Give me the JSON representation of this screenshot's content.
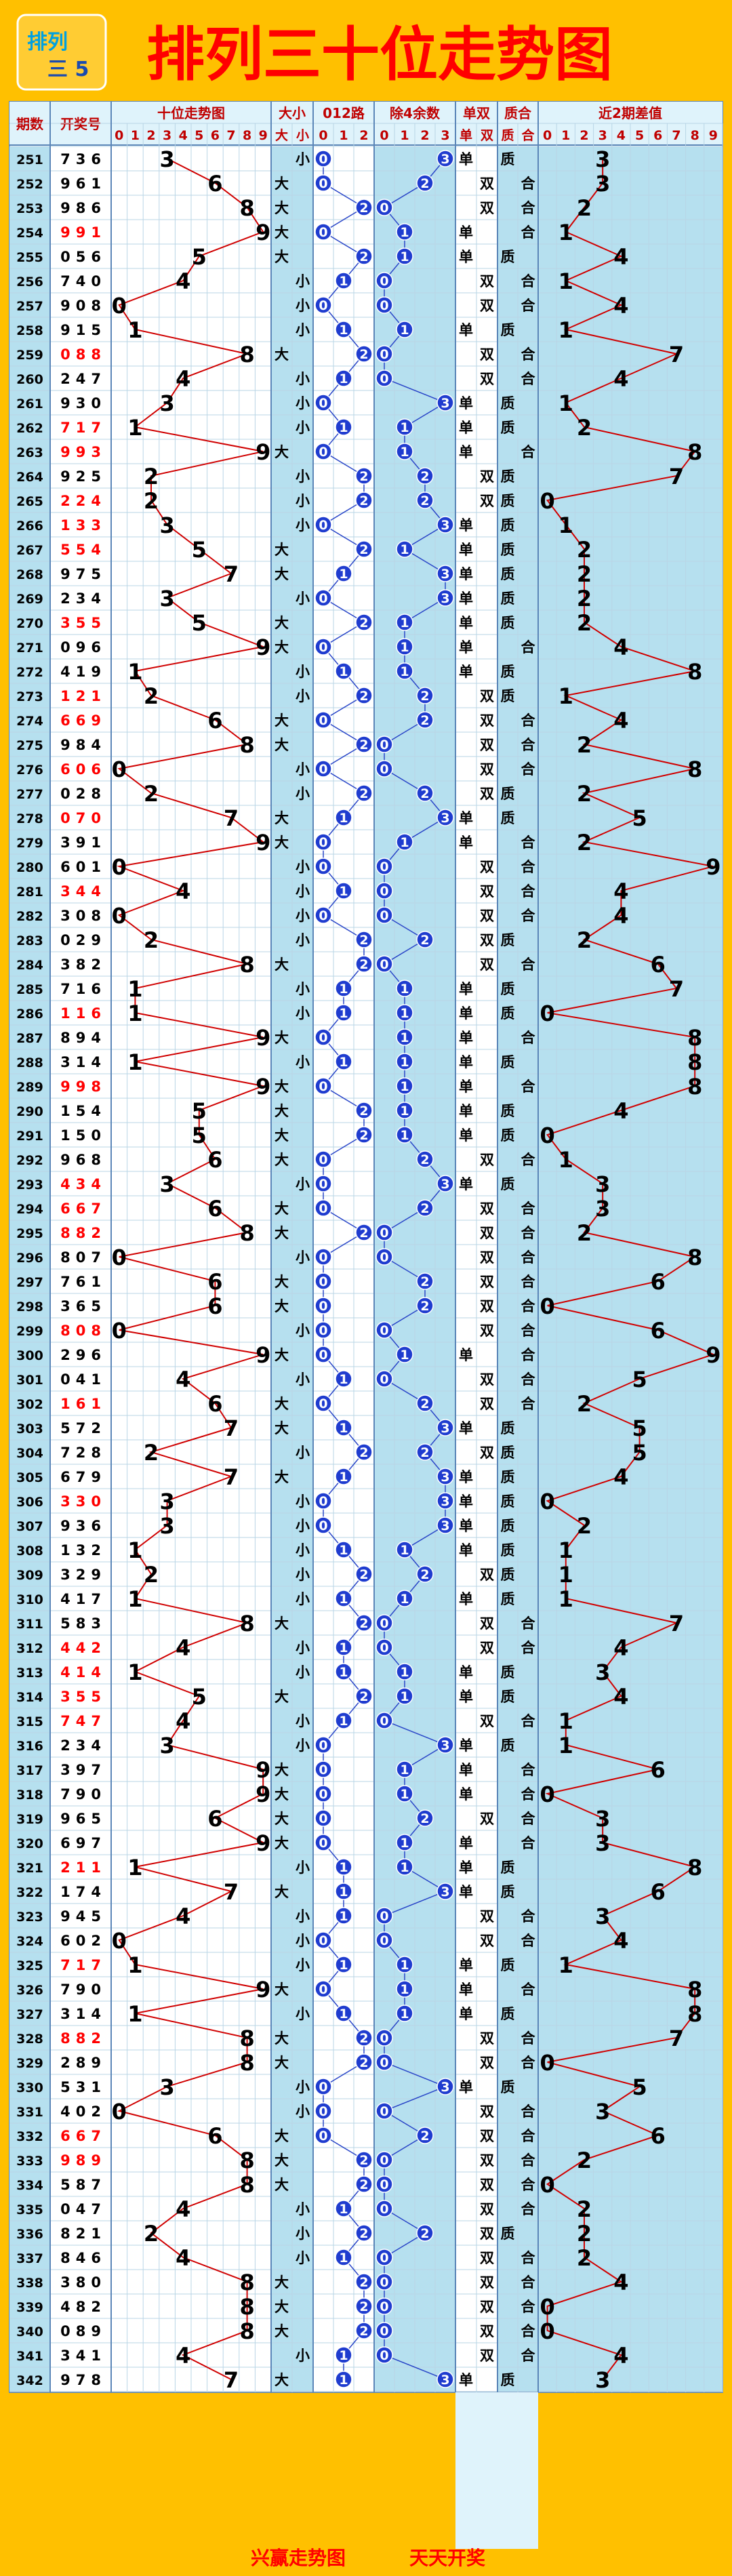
{
  "title": "排列三十位走势图",
  "logo_text": [
    "排列",
    "三 5"
  ],
  "footer": {
    "left": "兴赢走势图",
    "right": "天天开奖"
  },
  "headers": {
    "period": "期数",
    "draw": "开奖号",
    "tens_trend": "十位走势图",
    "big_small": "大小",
    "route012": "012路",
    "mod4": "除4余数",
    "odd_even": "单双",
    "prime_composite": "质合",
    "diff2": "近2期差值"
  },
  "sub_headers": {
    "tens_digits": [
      "0",
      "1",
      "2",
      "3",
      "4",
      "5",
      "6",
      "7",
      "8",
      "9"
    ],
    "big_small": [
      "大",
      "小"
    ],
    "route012": [
      "0",
      "1",
      "2"
    ],
    "mod4": [
      "0",
      "1",
      "2",
      "3"
    ],
    "odd_even": [
      "单",
      "双"
    ],
    "prime_composite": [
      "质",
      "合"
    ],
    "diff_digits": [
      "0",
      "1",
      "2",
      "3",
      "4",
      "5",
      "6",
      "7",
      "8",
      "9"
    ]
  },
  "colors": {
    "background": "#ffc000",
    "title": "#ff0000",
    "header_bg": "#dff3fb",
    "grid_line": "#b9d5e6",
    "trend_line": "#d00000",
    "circle": "#1f3ccf",
    "alt_bg": "#b6e0ef",
    "red_number": "#ff0000"
  },
  "chart_data": {
    "type": "table",
    "title": "排列三十位走势图",
    "periods": [
      251,
      252,
      253,
      254,
      255,
      256,
      257,
      258,
      259,
      260,
      261,
      262,
      263,
      264,
      265,
      266,
      267,
      268,
      269,
      270,
      271,
      272,
      273,
      274,
      275,
      276,
      277,
      278,
      279,
      280,
      281,
      282,
      283,
      284,
      285,
      286,
      287,
      288,
      289,
      290,
      291,
      292,
      293,
      294,
      295,
      296,
      297,
      298,
      299,
      300,
      301,
      302,
      303,
      304,
      305,
      306,
      307,
      308,
      309,
      310,
      311,
      312,
      313,
      314,
      315,
      316,
      317,
      318,
      319,
      320,
      321,
      322,
      323,
      324,
      325,
      326,
      327,
      328,
      329,
      330,
      331,
      332,
      333,
      334,
      335,
      336,
      337,
      338,
      339,
      340,
      341,
      342
    ],
    "draws": [
      "736",
      "961",
      "986",
      "991",
      "056",
      "740",
      "908",
      "915",
      "088",
      "247",
      "930",
      "717",
      "993",
      "925",
      "224",
      "133",
      "554",
      "975",
      "234",
      "355",
      "096",
      "419",
      "121",
      "669",
      "984",
      "606",
      "028",
      "070",
      "391",
      "601",
      "344",
      "308",
      "029",
      "382",
      "716",
      "116",
      "894",
      "314",
      "998",
      "154",
      "150",
      "968",
      "434",
      "667",
      "882",
      "807",
      "761",
      "365",
      "808",
      "296",
      "041",
      "161",
      "572",
      "728",
      "679",
      "330",
      "936",
      "132",
      "329",
      "417",
      "583",
      "442",
      "414",
      "355",
      "747",
      "234",
      "397",
      "790",
      "965",
      "697",
      "211",
      "174",
      "945",
      "602",
      "717",
      "790",
      "314",
      "882",
      "289",
      "531",
      "402",
      "667",
      "989",
      "587",
      "047",
      "821",
      "846",
      "380",
      "482",
      "089",
      "341",
      "978"
    ],
    "tens": [
      3,
      6,
      8,
      9,
      5,
      4,
      0,
      1,
      8,
      4,
      3,
      1,
      9,
      2,
      2,
      3,
      5,
      7,
      3,
      5,
      9,
      1,
      2,
      6,
      8,
      0,
      2,
      7,
      9,
      0,
      4,
      0,
      2,
      8,
      1,
      1,
      9,
      1,
      9,
      5,
      5,
      6,
      3,
      6,
      8,
      0,
      6,
      6,
      0,
      9,
      4,
      6,
      7,
      2,
      7,
      3,
      3,
      1,
      2,
      1,
      8,
      4,
      1,
      5,
      4,
      3,
      9,
      9,
      6,
      9,
      1,
      7,
      4,
      0,
      1,
      9,
      1,
      8,
      8,
      3,
      0,
      6,
      8,
      8,
      4,
      2,
      4,
      8,
      8,
      8,
      4,
      7
    ],
    "odd_even": [
      "单",
      "双",
      "双",
      "单",
      "单",
      "双",
      "双",
      "单",
      "双",
      "双",
      "单",
      "单",
      "单",
      "双",
      "双",
      "单",
      "单",
      "单",
      "单",
      "单",
      "单",
      "单",
      "双",
      "双",
      "双",
      "双",
      "双",
      "单",
      "单",
      "双",
      "双",
      "双",
      "双",
      "双",
      "单",
      "单",
      "单",
      "单",
      "单",
      "单",
      "单",
      "双",
      "单",
      "双",
      "双",
      "双",
      "双",
      "双",
      "双",
      "单",
      "双",
      "双",
      "单",
      "双",
      "单",
      "单",
      "单",
      "单",
      "双",
      "单",
      "双",
      "双",
      "单",
      "单",
      "双",
      "单",
      "单",
      "单",
      "双",
      "单",
      "单",
      "单",
      "双",
      "双",
      "单",
      "单",
      "单",
      "双",
      "双",
      "单",
      "双",
      "双",
      "双",
      "双",
      "双",
      "双",
      "双",
      "双",
      "双",
      "双",
      "双",
      "单"
    ],
    "prime_composite": [
      "质",
      "合",
      "合",
      "合",
      "质",
      "合",
      "合",
      "质",
      "合",
      "合",
      "质",
      "质",
      "合",
      "质",
      "质",
      "质",
      "质",
      "质",
      "质",
      "质",
      "合",
      "质",
      "质",
      "合",
      "合",
      "合",
      "质",
      "质",
      "合",
      "合",
      "合",
      "合",
      "质",
      "合",
      "质",
      "质",
      "合",
      "质",
      "合",
      "质",
      "质",
      "合",
      "质",
      "合",
      "合",
      "合",
      "合",
      "合",
      "合",
      "合",
      "合",
      "合",
      "质",
      "质",
      "质",
      "质",
      "质",
      "质",
      "质",
      "质",
      "合",
      "合",
      "质",
      "质",
      "合",
      "质",
      "合",
      "合",
      "合",
      "合",
      "质",
      "质",
      "合",
      "合",
      "质",
      "合",
      "质",
      "合",
      "合",
      "质",
      "合",
      "合",
      "合",
      "合",
      "合",
      "质",
      "合",
      "合",
      "合",
      "合",
      "合",
      "质"
    ],
    "diff2": [
      3,
      3,
      2,
      1,
      4,
      1,
      4,
      1,
      7,
      4,
      1,
      2,
      8,
      7,
      0,
      1,
      2,
      2,
      2,
      2,
      4,
      8,
      1,
      4,
      2,
      8,
      2,
      5,
      2,
      9,
      4,
      4,
      2,
      6,
      7,
      0,
      8,
      8,
      8,
      4,
      0,
      1,
      3,
      3,
      2,
      8,
      6,
      0,
      6,
      9,
      5,
      2,
      5,
      5,
      4,
      0,
      2,
      1,
      1,
      1,
      7,
      4,
      3,
      4,
      1,
      1,
      6,
      0,
      3,
      3,
      8,
      6,
      3,
      4,
      1,
      8,
      8,
      7,
      0,
      5,
      3,
      6,
      2,
      0,
      2,
      2,
      2,
      4,
      0,
      0,
      4,
      3
    ]
  }
}
